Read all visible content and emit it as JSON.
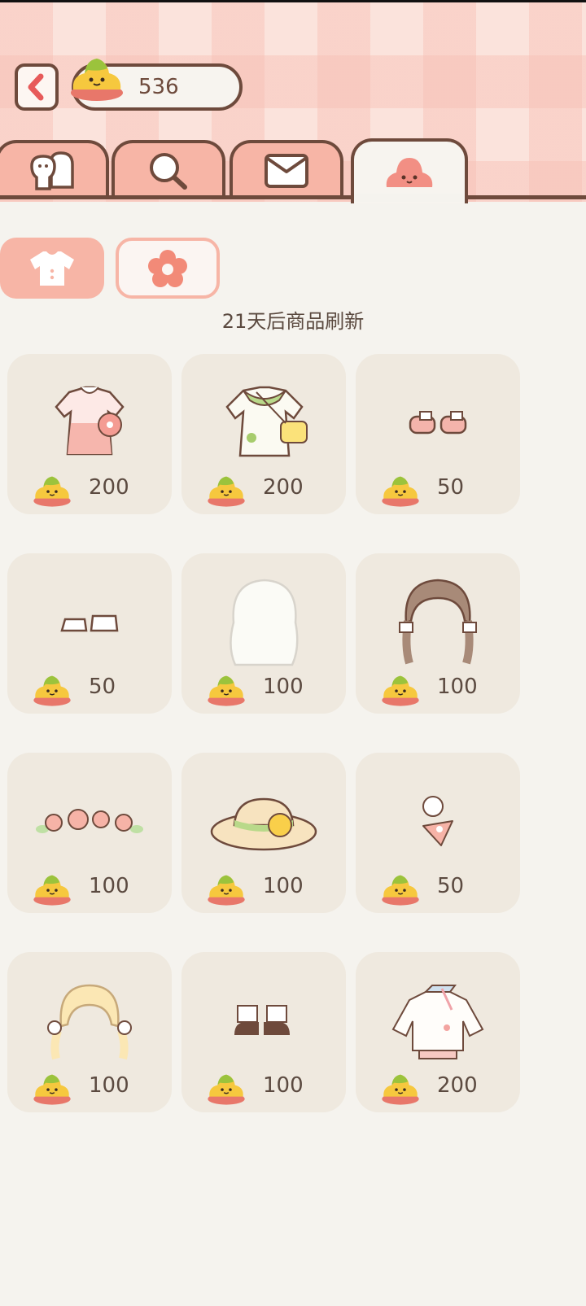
{
  "header": {
    "coins": "536"
  },
  "tabs": [
    {
      "name": "friends-tab",
      "icon": "ghost-friends-icon",
      "active": false
    },
    {
      "name": "search-tab",
      "icon": "magnifier-icon",
      "active": false
    },
    {
      "name": "mail-tab",
      "icon": "envelope-icon",
      "active": false
    },
    {
      "name": "shop-tab",
      "icon": "pink-blob-icon",
      "active": true
    }
  ],
  "subtabs": [
    {
      "icon": "shirt-icon",
      "active": true
    },
    {
      "icon": "flower-icon",
      "active": false
    }
  ],
  "refresh_text": "21天后商品刷新",
  "items": [
    {
      "art": "pink-floral-dress",
      "price": "200"
    },
    {
      "art": "green-dress-with-bag",
      "price": "200"
    },
    {
      "art": "pink-shoes",
      "price": "50"
    },
    {
      "art": "white-shoes",
      "price": "50"
    },
    {
      "art": "white-wavy-hair",
      "price": "100"
    },
    {
      "art": "brown-braided-hair",
      "price": "100"
    },
    {
      "art": "flower-crown",
      "price": "100"
    },
    {
      "art": "straw-hat",
      "price": "100"
    },
    {
      "art": "heart-hairpin",
      "price": "50"
    },
    {
      "art": "blonde-pigtails",
      "price": "100"
    },
    {
      "art": "brown-boots",
      "price": "100"
    },
    {
      "art": "white-jacket",
      "price": "200"
    }
  ],
  "colors": {
    "accent": "#f7b5a6",
    "outline": "#6e4a3c",
    "card": "#efe9df",
    "background": "#f5f3ee"
  }
}
